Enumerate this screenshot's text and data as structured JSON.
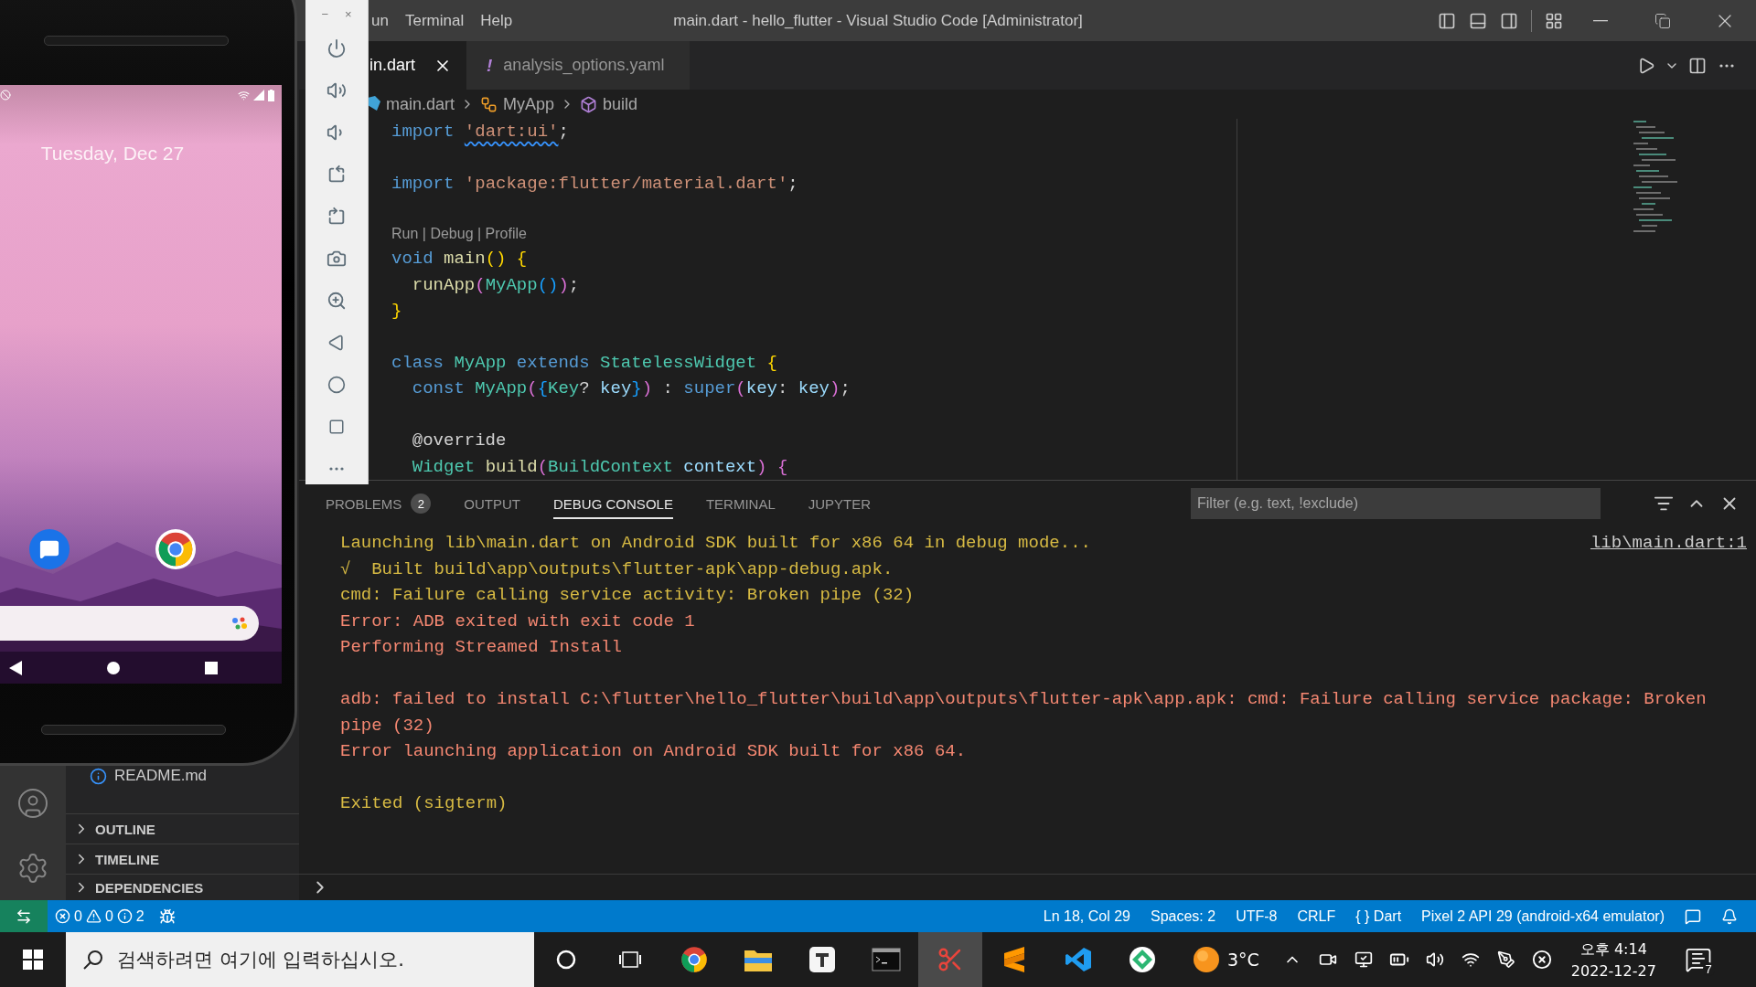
{
  "title_bar": {
    "menus": [
      {
        "label": "un"
      },
      {
        "label": "Terminal"
      },
      {
        "label": "Help"
      }
    ],
    "title": "main.dart - hello_flutter - Visual Studio Code [Administrator]"
  },
  "emulator": {
    "date": "Tuesday, Dec 27"
  },
  "emulator_toolbar": {
    "window_buttons": [
      "−",
      "×"
    ]
  },
  "sidebar": {
    "file": "README.md",
    "sections": [
      {
        "label": "OUTLINE",
        "expanded": false
      },
      {
        "label": "TIMELINE",
        "expanded": false
      },
      {
        "label": "DEPENDENCIES",
        "expanded": false
      }
    ]
  },
  "editor": {
    "tabs": [
      {
        "label": "in.dart",
        "selected": true
      },
      {
        "label": "analysis_options.yaml",
        "selected": false,
        "icon": "!"
      }
    ],
    "breadcrumb": [
      {
        "label": "main.dart",
        "kind": "file"
      },
      {
        "label": "MyApp",
        "kind": "class"
      },
      {
        "label": "build",
        "kind": "method"
      }
    ],
    "lines": [
      {
        "kind": "code",
        "tokens": [
          {
            "text": "import ",
            "kind": "keyword"
          },
          {
            "text": "'dart:ui'",
            "kind": "string",
            "squiggle": true
          },
          {
            "text": ";",
            "kind": "plain"
          }
        ]
      },
      {
        "kind": "blank"
      },
      {
        "kind": "code",
        "tokens": [
          {
            "text": "import ",
            "kind": "keyword"
          },
          {
            "text": "'package:flutter/material.dart'",
            "kind": "string"
          },
          {
            "text": ";",
            "kind": "plain"
          }
        ]
      },
      {
        "kind": "blank"
      },
      {
        "kind": "codelens",
        "text": "Run | Debug | Profile"
      },
      {
        "kind": "code",
        "tokens": [
          {
            "text": "void ",
            "kind": "keyword"
          },
          {
            "text": "main",
            "kind": "function"
          },
          {
            "text": "()",
            "kind": "bracket1"
          },
          {
            "text": " {",
            "kind": "bracket1"
          }
        ]
      },
      {
        "kind": "code",
        "tokens": [
          {
            "text": "  runApp",
            "kind": "function"
          },
          {
            "text": "(",
            "kind": "bracket2"
          },
          {
            "text": "MyApp",
            "kind": "type"
          },
          {
            "text": "()",
            "kind": "bracket3"
          },
          {
            "text": ")",
            "kind": "bracket2"
          },
          {
            "text": ";",
            "kind": "plain"
          }
        ]
      },
      {
        "kind": "code",
        "tokens": [
          {
            "text": "}",
            "kind": "bracket1"
          }
        ]
      },
      {
        "kind": "blank"
      },
      {
        "kind": "code",
        "tokens": [
          {
            "text": "class ",
            "kind": "keyword"
          },
          {
            "text": "MyApp ",
            "kind": "type"
          },
          {
            "text": "extends ",
            "kind": "keyword"
          },
          {
            "text": "StatelessWidget ",
            "kind": "type"
          },
          {
            "text": "{",
            "kind": "bracket1"
          }
        ]
      },
      {
        "kind": "code",
        "tokens": [
          {
            "text": "  const ",
            "kind": "keyword"
          },
          {
            "text": "MyApp",
            "kind": "type"
          },
          {
            "text": "(",
            "kind": "bracket2"
          },
          {
            "text": "{",
            "kind": "bracket3"
          },
          {
            "text": "Key",
            "kind": "type"
          },
          {
            "text": "? ",
            "kind": "plain"
          },
          {
            "text": "key",
            "kind": "param"
          },
          {
            "text": "}",
            "kind": "bracket3"
          },
          {
            "text": ")",
            "kind": "bracket2"
          },
          {
            "text": " : ",
            "kind": "plain"
          },
          {
            "text": "super",
            "kind": "keyword"
          },
          {
            "text": "(",
            "kind": "bracket2"
          },
          {
            "text": "key",
            "kind": "param"
          },
          {
            "text": ": ",
            "kind": "plain"
          },
          {
            "text": "key",
            "kind": "param"
          },
          {
            "text": ")",
            "kind": "bracket2"
          },
          {
            "text": ";",
            "kind": "plain"
          }
        ]
      },
      {
        "kind": "blank"
      },
      {
        "kind": "code",
        "tokens": [
          {
            "text": "  @override",
            "kind": "plain"
          }
        ]
      },
      {
        "kind": "code",
        "tokens": [
          {
            "text": "  Widget ",
            "kind": "type"
          },
          {
            "text": "build",
            "kind": "function"
          },
          {
            "text": "(",
            "kind": "bracket2"
          },
          {
            "text": "BuildContext ",
            "kind": "type"
          },
          {
            "text": "context",
            "kind": "param"
          },
          {
            "text": ")",
            "kind": "bracket2"
          },
          {
            "text": " {",
            "kind": "bracket2"
          }
        ]
      }
    ]
  },
  "panel": {
    "tabs": [
      {
        "label": "PROBLEMS",
        "badge": "2",
        "selected": false
      },
      {
        "label": "OUTPUT",
        "selected": false
      },
      {
        "label": "DEBUG CONSOLE",
        "selected": true
      },
      {
        "label": "TERMINAL",
        "selected": false
      },
      {
        "label": "JUPYTER",
        "selected": false
      }
    ],
    "filter": {
      "placeholder": "Filter (e.g. text, !exclude)"
    },
    "source_link": "lib\\main.dart:1",
    "console": [
      {
        "kind": "info",
        "text": "Launching lib\\main.dart on Android SDK built for x86 64 in debug mode..."
      },
      {
        "kind": "info",
        "text": "√  Built build\\app\\outputs\\flutter-apk\\app-debug.apk."
      },
      {
        "kind": "info",
        "text": "cmd: Failure calling service activity: Broken pipe (32)"
      },
      {
        "kind": "error",
        "text": "Error: ADB exited with exit code 1"
      },
      {
        "kind": "error",
        "text": "Performing Streamed Install"
      },
      {
        "kind": "blank"
      },
      {
        "kind": "error",
        "text": "adb: failed to install C:\\flutter\\hello_flutter\\build\\app\\outputs\\flutter-apk\\app.apk: cmd: Failure calling service package: Broken pipe (32)"
      },
      {
        "kind": "error",
        "text": "Error launching application on Android SDK built for x86 64."
      },
      {
        "kind": "blank"
      },
      {
        "kind": "info",
        "text": "Exited (sigterm)"
      }
    ]
  },
  "status_bar": {
    "errors": "0",
    "warnings": "0",
    "infos": "2",
    "items": [
      {
        "label": "Ln 18, Col 29"
      },
      {
        "label": "Spaces: 2"
      },
      {
        "label": "UTF-8"
      },
      {
        "label": "CRLF"
      },
      {
        "label": "{ } Dart"
      },
      {
        "label": "Pixel 2 API 29 (android-x64 emulator)"
      }
    ]
  },
  "taskbar": {
    "search": {
      "placeholder": "검색하려면 여기에 입력하십시오."
    },
    "apps": [
      {
        "kind": "chrome",
        "active": false
      },
      {
        "kind": "explorer",
        "active": false
      },
      {
        "kind": "typora",
        "active": false
      },
      {
        "kind": "console",
        "active": false
      },
      {
        "kind": "snipping",
        "active": true
      },
      {
        "kind": "sublime",
        "active": false
      },
      {
        "kind": "vscode",
        "active": false
      },
      {
        "kind": "emulator",
        "active": false
      }
    ],
    "weather": "3°C",
    "time": "오후 4:14",
    "date": "2022-12-27",
    "notifications": "7"
  }
}
